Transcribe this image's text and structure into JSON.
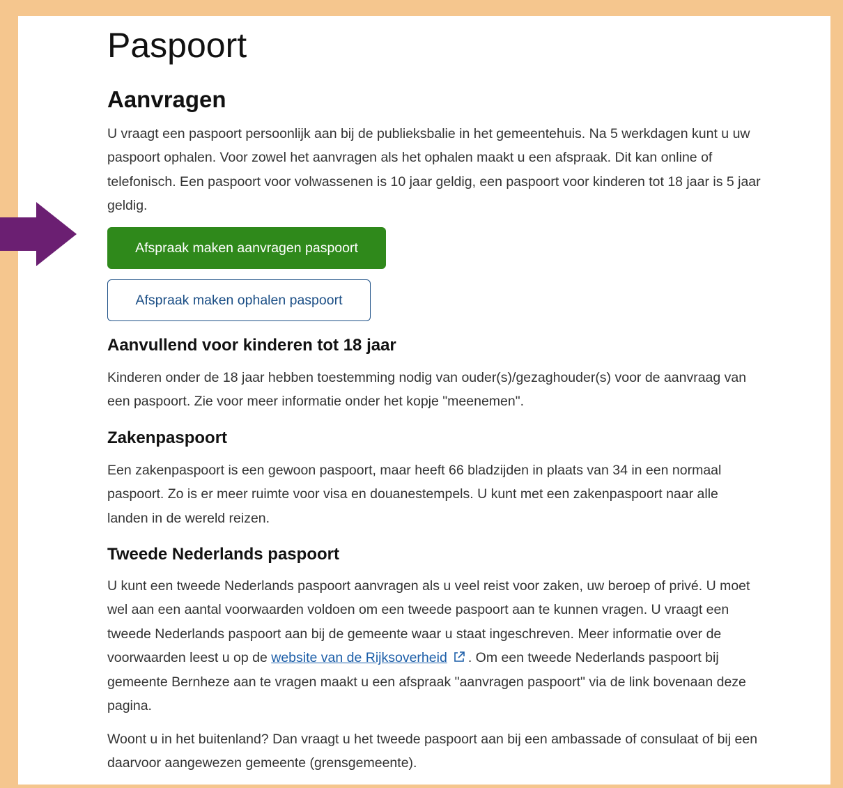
{
  "page": {
    "title": "Paspoort"
  },
  "section": {
    "title": "Aanvragen",
    "intro": "U vraagt een paspoort persoonlijk aan bij de publieksbalie in het gemeentehuis. Na 5 werkdagen kunt u uw paspoort ophalen. Voor zowel het aanvragen als het ophalen maakt u een afspraak. Dit kan online of telefonisch. Een paspoort voor volwassenen is 10 jaar geldig, een paspoort voor kinderen tot 18 jaar is 5 jaar geldig."
  },
  "buttons": {
    "primary_label": "Afspraak maken aanvragen paspoort",
    "secondary_label": "Afspraak maken ophalen paspoort"
  },
  "kinderen": {
    "title": "Aanvullend voor kinderen tot 18 jaar",
    "text": "Kinderen onder de 18 jaar hebben toestemming nodig van ouder(s)/gezaghouder(s) voor de aanvraag van een paspoort. Zie voor meer informatie onder het kopje \"meenemen\"."
  },
  "zaken": {
    "title": "Zakenpaspoort",
    "text": "Een zakenpaspoort is een gewoon paspoort, maar heeft 66 bladzijden in plaats van 34 in een normaal paspoort. Zo is er meer ruimte voor visa en douanestempels. U kunt met een zakenpaspoort naar alle landen in de wereld reizen."
  },
  "tweede": {
    "title": "Tweede Nederlands paspoort",
    "text_before_link": "U kunt een tweede Nederlands paspoort aanvragen als u veel reist voor zaken, uw beroep of privé. U moet wel aan een aantal voorwaarden voldoen om een tweede paspoort aan te kunnen vragen. U vraagt een tweede Nederlands paspoort aan bij de gemeente waar u staat ingeschreven. Meer informatie over de voorwaarden leest u op de ",
    "link_text": "website van de Rijksoverheid",
    "text_after_link": ". Om een tweede Nederlands paspoort bij gemeente Bernheze aan te vragen maakt u een afspraak \"aanvragen paspoort\" via de link bovenaan deze pagina.",
    "buitenland": "Woont u in het buitenland? Dan vraagt u het tweede paspoort aan bij een ambassade of consulaat of bij een daarvoor aangewezen gemeente (grensgemeente)."
  },
  "colors": {
    "primary_button": "#2f891b",
    "link": "#1c5ea8",
    "arrow": "#6b1f72",
    "border": "#f5c68e"
  },
  "icons": {
    "arrow": "right-arrow-icon",
    "external": "external-link-icon"
  }
}
